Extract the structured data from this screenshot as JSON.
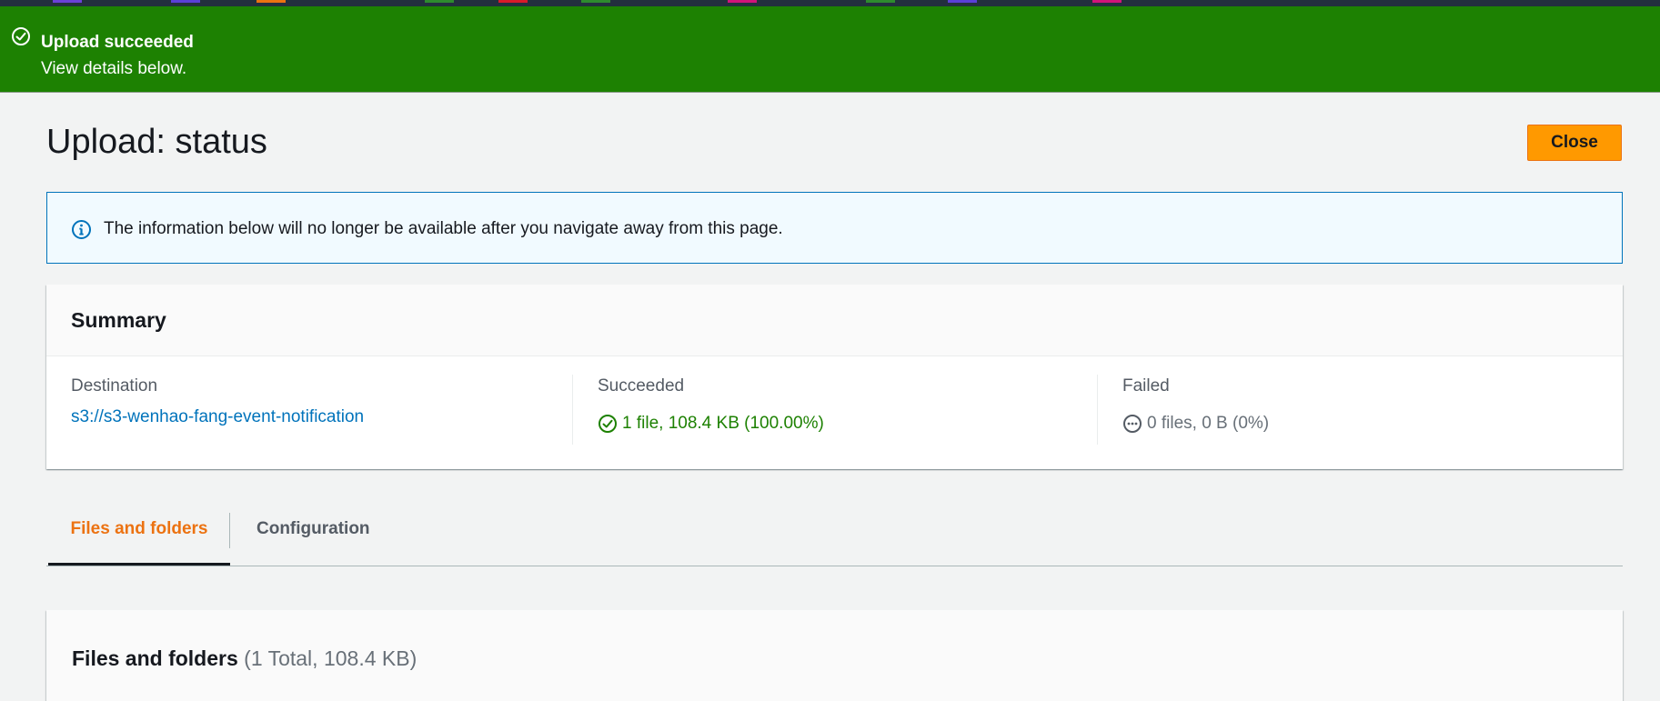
{
  "colors": {
    "flash_success": "#1d8102",
    "primary_button": "#ff9900",
    "link": "#0073bb",
    "active_tab": "#ec7211",
    "info_border": "#0073bb",
    "info_bg": "#f1faff"
  },
  "top_strip": {
    "segment_colors": [
      "#6b40d8",
      "#5a3fd8",
      "#ec7211",
      "#2e8b2e",
      "#d91a2a",
      "#2e8b2e",
      "#d1137a",
      "#2e8b2e",
      "#5a3fd8",
      "#d1137a"
    ]
  },
  "flash": {
    "icon": "check-circle-icon",
    "title": "Upload succeeded",
    "message": "View details below."
  },
  "header": {
    "title": "Upload: status",
    "close_label": "Close"
  },
  "info_alert": {
    "icon": "info-icon",
    "text": "The information below will no longer be available after you navigate away from this page."
  },
  "summary": {
    "title": "Summary",
    "destination": {
      "label": "Destination",
      "value": "s3://s3-wenhao-fang-event-notification"
    },
    "succeeded": {
      "label": "Succeeded",
      "icon": "check-circle-icon",
      "value": "1 file, 108.4 KB (100.00%)"
    },
    "failed": {
      "label": "Failed",
      "icon": "ellipsis-circle-icon",
      "value": "0 files, 0 B (0%)"
    }
  },
  "tabs": [
    {
      "label": "Files and folders",
      "active": true
    },
    {
      "label": "Configuration",
      "active": false
    }
  ],
  "files_panel": {
    "title": "Files and folders",
    "count": "(1 Total, 108.4 KB)"
  }
}
